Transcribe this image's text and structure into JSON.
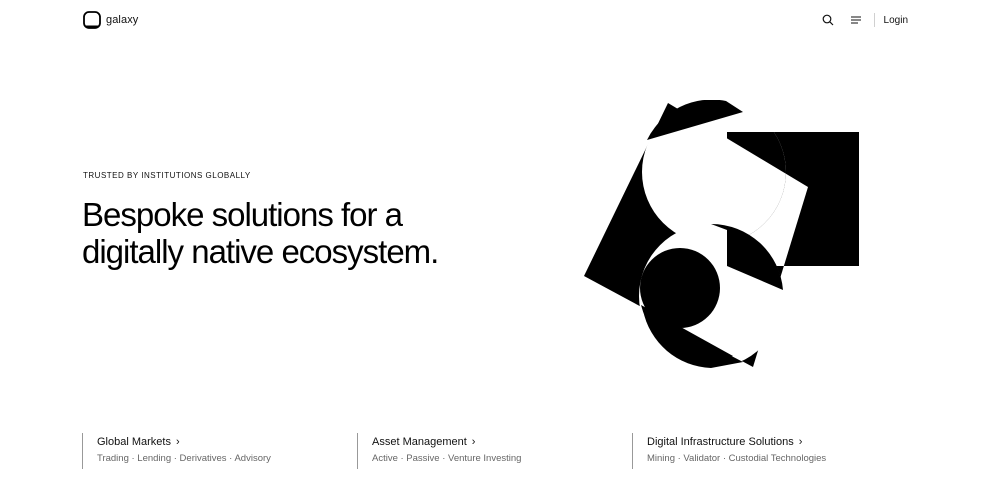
{
  "header": {
    "logo_text": "galaxy",
    "login_label": "Login"
  },
  "hero": {
    "eyebrow": "TRUSTED BY INSTITUTIONS GLOBALLY",
    "headline_line1": "Bespoke solutions for a",
    "headline_line2": "digitally native ecosystem."
  },
  "cards": [
    {
      "title": "Global Markets",
      "chevron": "›",
      "subtitle": "Trading · Lending · Derivatives · Advisory"
    },
    {
      "title": "Asset Management",
      "chevron": "›",
      "subtitle": "Active · Passive · Venture Investing"
    },
    {
      "title": "Digital Infrastructure Solutions",
      "chevron": "›",
      "subtitle": "Mining · Validator · Custodial Technologies"
    }
  ],
  "icons": {
    "logo": "galaxy-logo-icon",
    "search": "search-icon",
    "menu": "menu-icon",
    "chevron": "chevron-right-icon"
  },
  "colors": {
    "text": "#000000",
    "muted": "#666666",
    "background": "#ffffff"
  }
}
